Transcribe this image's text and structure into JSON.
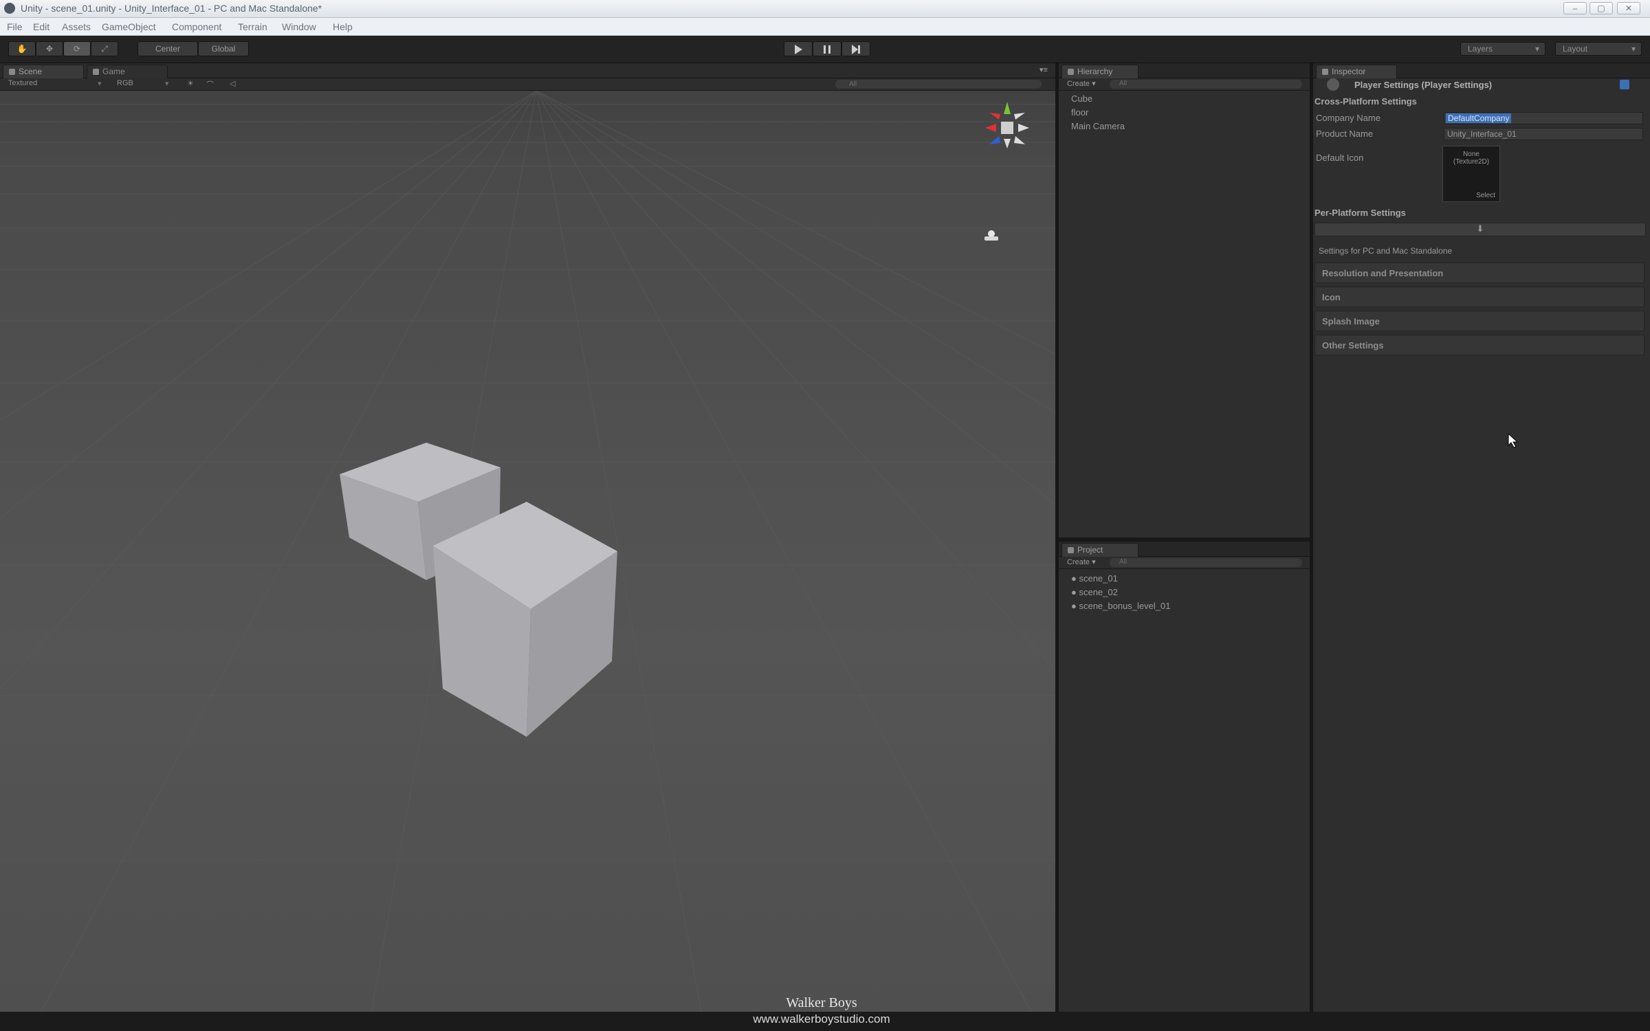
{
  "window": {
    "title": "Unity - scene_01.unity - Unity_Interface_01 - PC and Mac Standalone*",
    "controls": [
      "–",
      "▢",
      "✕"
    ]
  },
  "menu": [
    "File",
    "Edit",
    "Assets",
    "GameObject",
    "Component",
    "Terrain",
    "Window",
    "Help"
  ],
  "toolbar": {
    "pivot": "Center",
    "space": "Global",
    "play_icon": "play-icon",
    "pause_icon": "pause-icon",
    "step_icon": "step-icon",
    "layers": "Layers",
    "layout": "Layout"
  },
  "scene_view": {
    "tabs": [
      "Scene",
      "Game"
    ],
    "render_mode": "Textured",
    "color_mode": "RGB",
    "options": [
      "☀",
      "⌒",
      "◁"
    ],
    "search_placeholder": "All"
  },
  "hierarchy": {
    "tab": "Hierarchy",
    "create": "Create ▾",
    "search_placeholder": "All",
    "items": [
      "Cube",
      "floor",
      "Main Camera"
    ]
  },
  "project": {
    "tab": "Project",
    "create": "Create ▾",
    "search_placeholder": "All",
    "items": [
      "scene_01",
      "scene_02",
      "scene_bonus_level_01"
    ]
  },
  "inspector": {
    "tab": "Inspector",
    "header": "Player Settings (Player Settings)",
    "cross_platform": "Cross-Platform Settings",
    "company_name_label": "Company Name",
    "company_name_value": "DefaultCompany",
    "product_name_label": "Product Name",
    "product_name_value": "Unity_Interface_01",
    "default_icon_label": "Default Icon",
    "icon_none": "None",
    "icon_type": "(Texture2D)",
    "icon_select": "Select",
    "per_platform": "Per-Platform Settings",
    "platform_note": "Settings for PC and Mac Standalone",
    "sections": [
      "Resolution and Presentation",
      "Icon",
      "Splash Image",
      "Other Settings"
    ]
  },
  "watermark": {
    "brand": "Walker Boys",
    "url": "www.walkerboystudio.com"
  },
  "colors": {
    "background": "#2a2a2a",
    "viewport": "#4e4e4e",
    "cube_top": "#b9b9bd",
    "cube_side": "#9e9ea2",
    "selection": "#3d6fb6"
  }
}
